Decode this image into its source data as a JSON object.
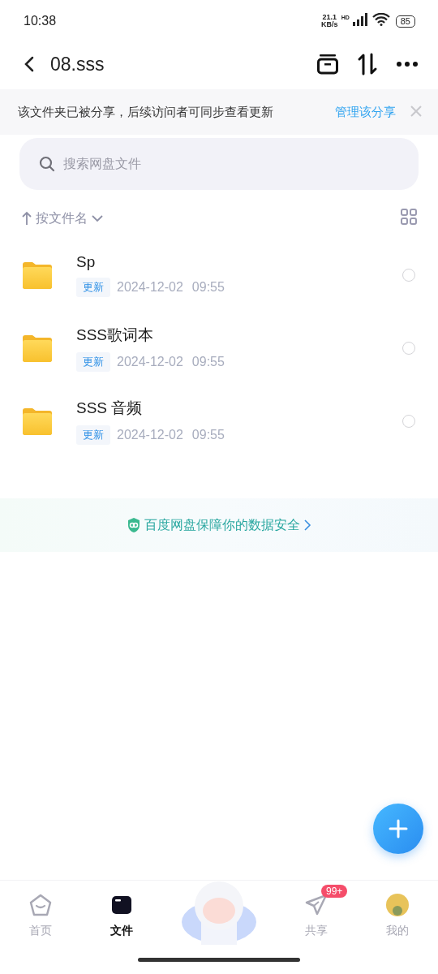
{
  "status_bar": {
    "time": "10:38",
    "net_speed": "21.1",
    "net_unit": "KB/s",
    "network": "HD",
    "battery": "85"
  },
  "header": {
    "title": "08.sss"
  },
  "share_notice": {
    "text": "该文件夹已被分享，后续访问者可同步查看更新",
    "link": "管理该分享"
  },
  "search": {
    "placeholder": "搜索网盘文件"
  },
  "sort": {
    "label": "按文件名"
  },
  "files": [
    {
      "name": "Sp",
      "tag": "更新",
      "date": "2024-12-02",
      "time": "09:55",
      "selected": false
    },
    {
      "name": "SSS歌词本",
      "tag": "更新",
      "date": "2024-12-02",
      "time": "09:55",
      "selected": false
    },
    {
      "name": "SSS 音频",
      "tag": "更新",
      "date": "2024-12-02",
      "time": "09:55",
      "selected": false
    }
  ],
  "security_banner": {
    "text": "百度网盘保障你的数据安全"
  },
  "tab_bar": [
    {
      "kind": "home",
      "label": "首页",
      "selected": false
    },
    {
      "kind": "files",
      "label": "文件",
      "selected": true
    },
    {
      "kind": "mascot",
      "selected": false
    },
    {
      "kind": "share",
      "label": "共享",
      "badge": "99+",
      "selected": false
    },
    {
      "kind": "avatar",
      "label": "我的",
      "selected": false
    }
  ]
}
